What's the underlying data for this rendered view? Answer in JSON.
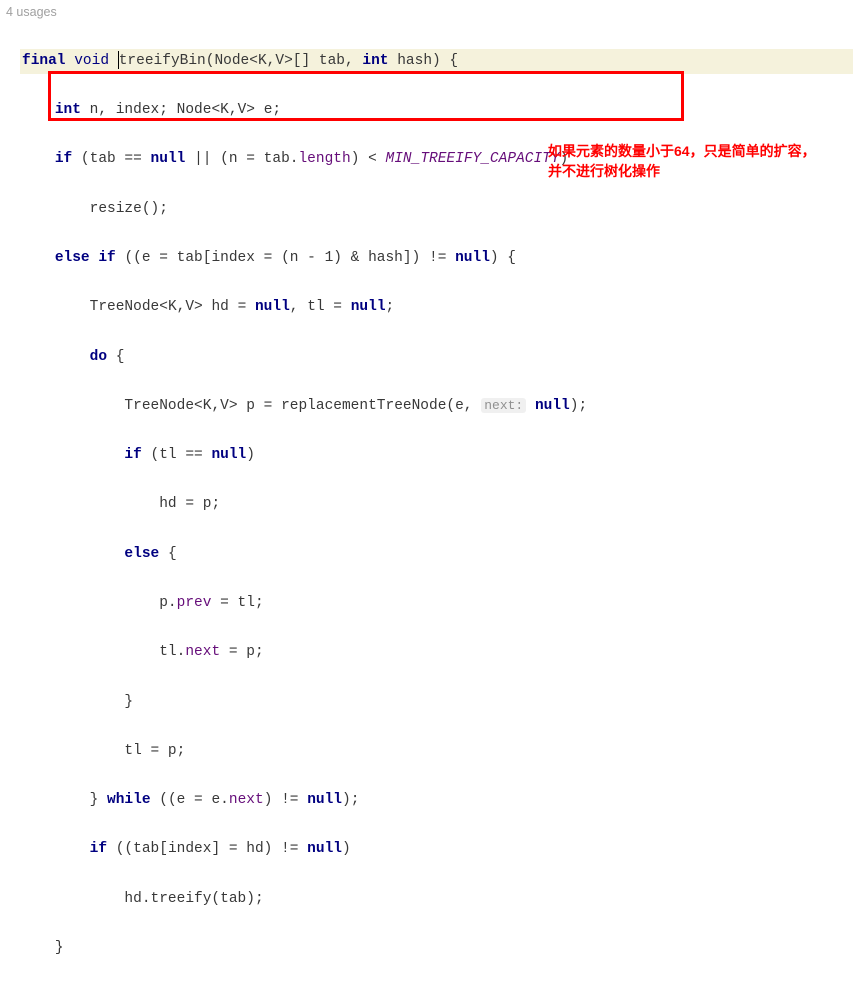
{
  "usages": "4 usages",
  "sig": {
    "final": "final",
    "void": "void",
    "name": "treeifyBin",
    "node": "Node",
    "kv": "<K,V>",
    "arr": "[] tab,",
    "intk": "int",
    "hash": "hash) {"
  },
  "l2": {
    "intk": "int",
    "vars": "n, index;",
    "node": "Node",
    "kv": "<K,V>",
    "e": "e;"
  },
  "l3": {
    "ifk": "if",
    "p1": "(tab ==",
    "nullk": "null",
    "p2": "|| (n = tab.",
    "length": "length",
    "p3": ") <",
    "const": "MIN_TREEIFY_CAPACITY",
    "p4": ")"
  },
  "l4": {
    "resize": "resize();"
  },
  "l5": {
    "elsek": "else if",
    "p1": "((e = tab[index = (n - 1) & hash]) !=",
    "nullk": "null",
    "p2": ") {"
  },
  "l6": {
    "tn": "TreeNode",
    "kv": "<K,V>",
    "hd": "hd =",
    "null1": "null",
    "c": ", tl =",
    "null2": "null",
    "s": ";"
  },
  "l7": {
    "dok": "do",
    "b": "{"
  },
  "l8": {
    "tn": "TreeNode",
    "kv": "<K,V>",
    "peq": "p = replacementTreeNode(e,",
    "hint": "next:",
    "nullk": "null",
    "p2": ");"
  },
  "l9": {
    "ifk": "if",
    "p1": "(tl ==",
    "nullk": "null",
    "p2": ")"
  },
  "l10": {
    "t": "hd = p;"
  },
  "l11": {
    "elsek": "else",
    "b": "{"
  },
  "l12": {
    "p": "p.",
    "prev": "prev",
    "eq": " = tl;"
  },
  "l13": {
    "t": "tl.",
    "next": "next",
    "eq": " = p;"
  },
  "l14": {
    "b": "}"
  },
  "l15": {
    "t": "tl = p;"
  },
  "l16": {
    "b": "}",
    "whilek": "while",
    "p1": "((e = e.",
    "next": "next",
    "p2": ") !=",
    "nullk": "null",
    "p3": ");"
  },
  "l17": {
    "ifk": "if",
    "p1": "((tab[index] = hd) !=",
    "nullk": "null",
    "p2": ")"
  },
  "l18": {
    "t": "hd.treeify(tab);"
  },
  "l19": {
    "b": "}"
  },
  "annotation": {
    "line1": "如果元素的数量小于64，只是简单的扩容，",
    "line2": "并不进行树化操作"
  }
}
